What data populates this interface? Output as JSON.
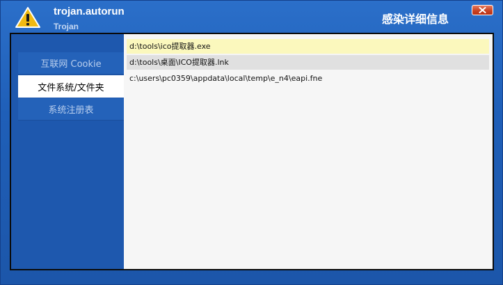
{
  "header": {
    "threat_name": "trojan.autorun",
    "threat_type": "Trojan",
    "dialog_title": "感染详细信息"
  },
  "colors": {
    "title_bar": "#1f5fb8",
    "selected_row": "#fbf8bd",
    "close_button": "#c94425"
  },
  "icons": {
    "warning": "warning-triangle-icon",
    "close": "close-x-icon"
  },
  "sidebar": {
    "items": [
      {
        "label": "互联网 Cookie",
        "active": false
      },
      {
        "label": "文件系统/文件夹",
        "active": true
      },
      {
        "label": "系统注册表",
        "active": false
      }
    ]
  },
  "files": [
    "d:\\tools\\ico提取器.exe",
    "d:\\tools\\桌面\\ICO提取器.lnk",
    "c:\\users\\pc0359\\appdata\\local\\temp\\e_n4\\eapi.fne"
  ]
}
